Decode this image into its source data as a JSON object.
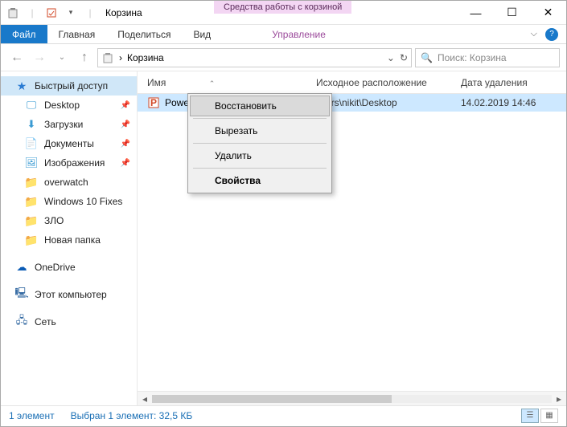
{
  "window": {
    "title": "Корзина",
    "contextual_tab": "Средства работы с корзиной"
  },
  "ribbon": {
    "file": "Файл",
    "home": "Главная",
    "share": "Поделиться",
    "view": "Вид",
    "manage": "Управление"
  },
  "address": {
    "crumb_sep": "›",
    "location": "Корзина",
    "refresh": "↻",
    "dropdown": "⌄",
    "search_placeholder": "Поиск: Корзина"
  },
  "sidebar": {
    "quick_access": "Быстрый доступ",
    "desktop": "Desktop",
    "downloads": "Загрузки",
    "documents": "Документы",
    "pictures": "Изображения",
    "overwatch": "overwatch",
    "win10fixes": "Windows 10 Fixes",
    "zlo": "ЗЛО",
    "newfolder": "Новая папка",
    "onedrive": "OneDrive",
    "thispc": "Этот компьютер",
    "network": "Сеть"
  },
  "columns": {
    "name": "Имя",
    "original_location": "Исходное расположение",
    "date_deleted": "Дата удаления"
  },
  "rows": [
    {
      "name": "PowerP",
      "location": "Jsers\\nikit\\Desktop",
      "date": "14.02.2019 14:46"
    }
  ],
  "context_menu": {
    "restore": "Восстановить",
    "cut": "Вырезать",
    "delete": "Удалить",
    "properties": "Свойства"
  },
  "status": {
    "count": "1 элемент",
    "selection": "Выбран 1 элемент: 32,5 КБ"
  }
}
